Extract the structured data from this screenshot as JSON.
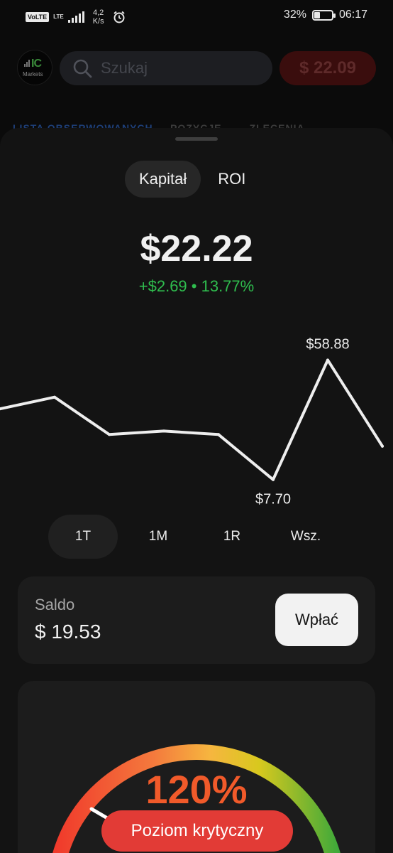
{
  "status_bar": {
    "volte": "VoLTE",
    "lte": "LTE",
    "speed_value": "4,2",
    "speed_unit": "K/s",
    "battery_percent": "32%",
    "battery_level": 0.32,
    "time": "06:17"
  },
  "top_bar": {
    "logo_mark": "IC",
    "logo_text": "Markets",
    "search_placeholder": "Szukaj",
    "balance": "$ 22.09"
  },
  "background_tabs": [
    "LISTA OBSERWOWANYCH",
    "POZYCJE",
    "ZLECENIA"
  ],
  "sheet": {
    "toggle": [
      {
        "label": "Kapitał",
        "active": true
      },
      {
        "label": "ROI",
        "active": false
      }
    ],
    "equity_value": "$22.22",
    "equity_change": "+$2.69 • 13.77%",
    "periods": [
      {
        "label": "1T",
        "active": true
      },
      {
        "label": "1M",
        "active": false
      },
      {
        "label": "1R",
        "active": false
      },
      {
        "label": "Wsz.",
        "active": false
      }
    ],
    "balance_label": "Saldo",
    "balance_value": "$ 19.53",
    "deposit_button": "Wpłać",
    "margin_level": "120%",
    "margin_status": "Poziom krytyczny"
  },
  "chart_data": {
    "type": "line",
    "y": [
      38,
      43,
      27,
      28.5,
      27,
      7.7,
      58.88,
      22
    ],
    "ylim": [
      0,
      70
    ],
    "max_label": "$58.88",
    "min_label": "$7.70",
    "line_color": "#eeeeee"
  },
  "colors": {
    "positive": "#2fbd4e",
    "critical": "#e23b36",
    "margin_value": "#f15a2a"
  }
}
